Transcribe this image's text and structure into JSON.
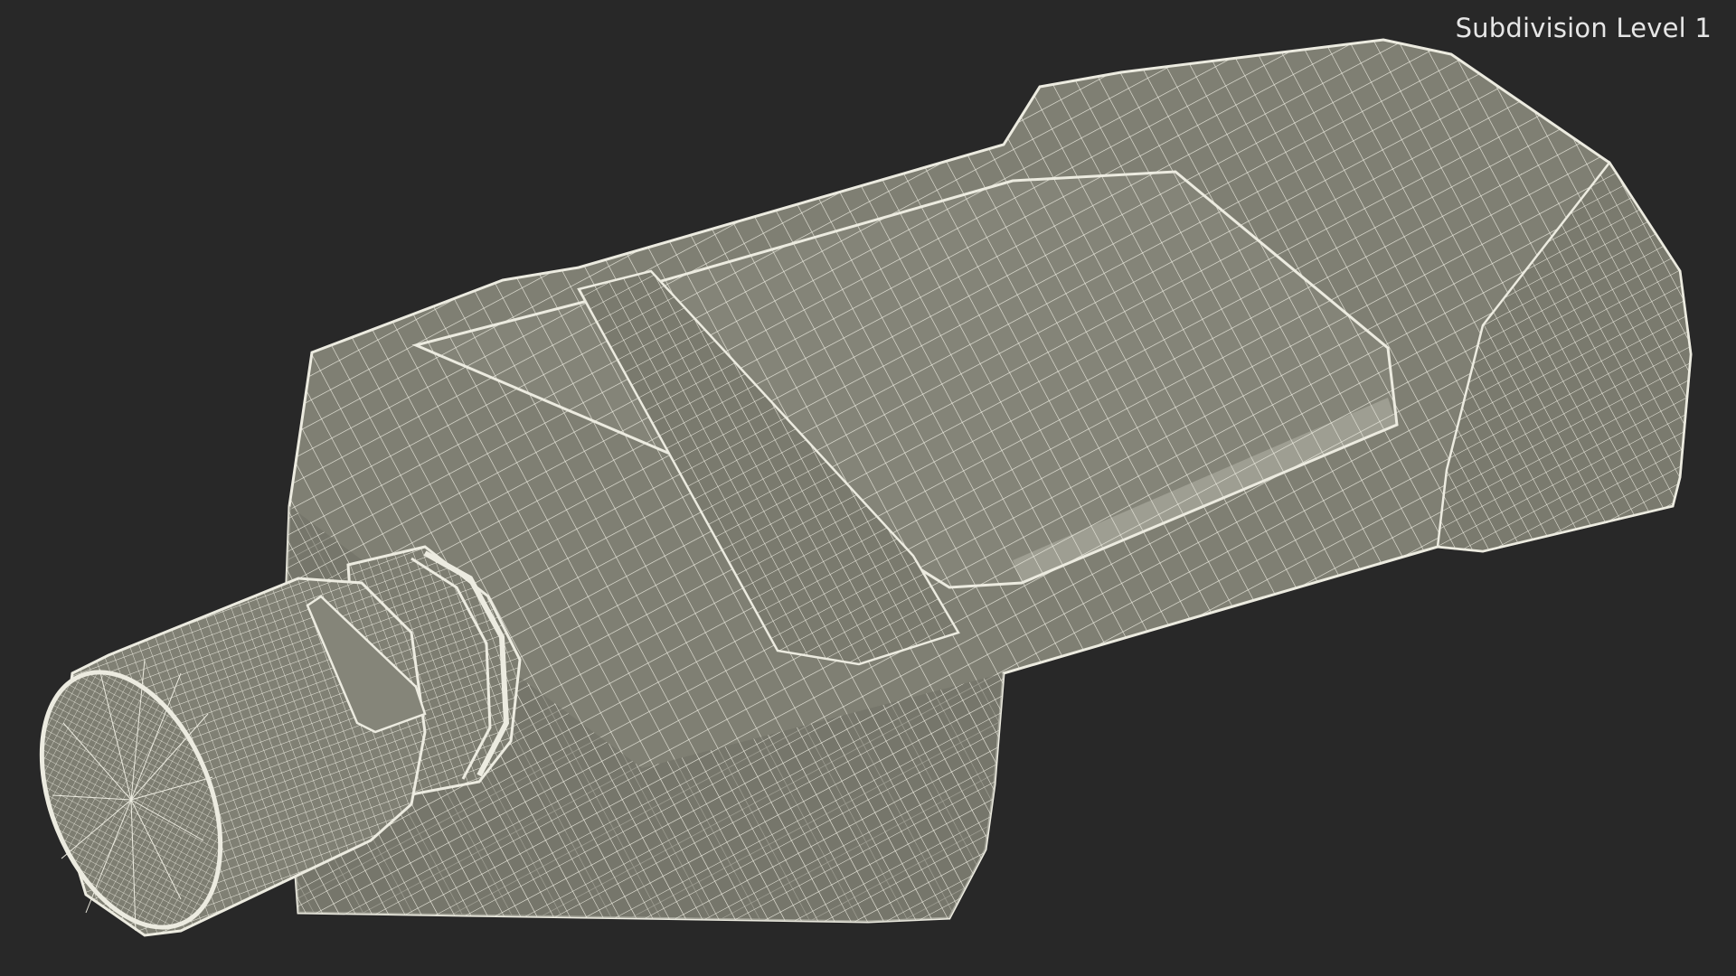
{
  "viewport": {
    "overlay_label": "Subdivision Level 1",
    "background_color": "#282828",
    "model_fill_color": "#7f7f73",
    "model_shade_color": "#6f6f64",
    "wire_color": "#ecebe0"
  }
}
